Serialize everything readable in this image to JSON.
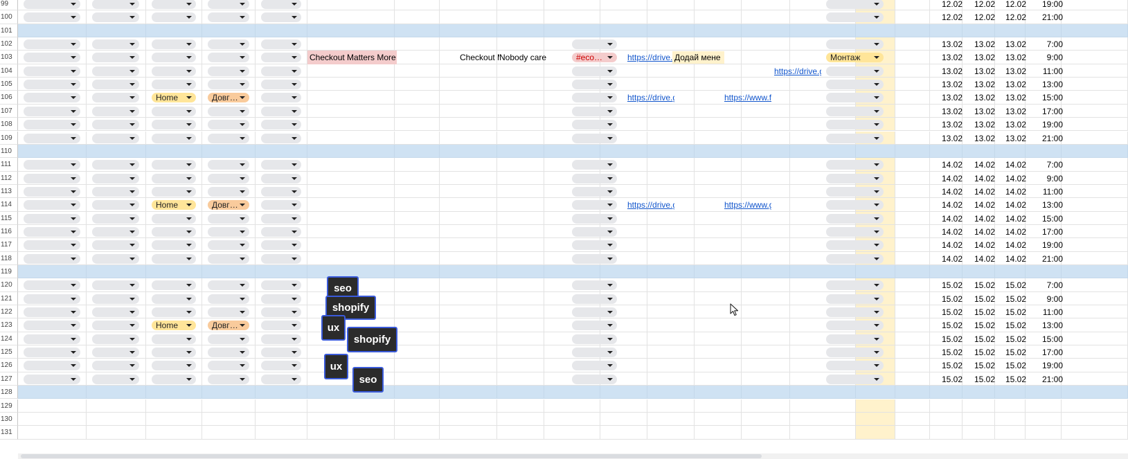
{
  "rows": [
    {
      "n": "99",
      "type": "data",
      "date": "12.02",
      "time": "19:00"
    },
    {
      "n": "100",
      "type": "data",
      "date": "12.02",
      "time": "21:00"
    },
    {
      "n": "101",
      "type": "sep"
    },
    {
      "n": "102",
      "type": "data",
      "date": "13.02",
      "time": "7:00",
      "c9": true
    },
    {
      "n": "103",
      "type": "data",
      "date": "13.02",
      "time": "9:00",
      "headline": "Checkout Matters More",
      "title": "Checkout Matte",
      "desc": "Nobody care",
      "c9": true,
      "hashtag": "#eco…",
      "link1": "https://drive.g",
      "note": "Додай мене",
      "stage": "Монтаж"
    },
    {
      "n": "104",
      "type": "data",
      "date": "13.02",
      "time": "11:00",
      "c9": true,
      "link3": "https://drive.g"
    },
    {
      "n": "105",
      "type": "data",
      "date": "13.02",
      "time": "13:00",
      "c9": true
    },
    {
      "n": "106",
      "type": "data",
      "date": "13.02",
      "time": "15:00",
      "c9": true,
      "cat": "Home",
      "dur": "Довг…",
      "link1": "https://drive.g",
      "link2": "https://www.f"
    },
    {
      "n": "107",
      "type": "data",
      "date": "13.02",
      "time": "17:00",
      "c9": true
    },
    {
      "n": "108",
      "type": "data",
      "date": "13.02",
      "time": "19:00",
      "c9": true
    },
    {
      "n": "109",
      "type": "data",
      "date": "13.02",
      "time": "21:00",
      "c9": true
    },
    {
      "n": "110",
      "type": "sep"
    },
    {
      "n": "111",
      "type": "data",
      "date": "14.02",
      "time": "7:00",
      "c9": true
    },
    {
      "n": "112",
      "type": "data",
      "date": "14.02",
      "time": "9:00",
      "c9": true
    },
    {
      "n": "113",
      "type": "data",
      "date": "14.02",
      "time": "11:00",
      "c9": true
    },
    {
      "n": "114",
      "type": "data",
      "date": "14.02",
      "time": "13:00",
      "c9": true,
      "cat": "Home",
      "dur": "Довг…",
      "link1": "https://drive.g",
      "link2": "https://www.g"
    },
    {
      "n": "115",
      "type": "data",
      "date": "14.02",
      "time": "15:00",
      "c9": true
    },
    {
      "n": "116",
      "type": "data",
      "date": "14.02",
      "time": "17:00",
      "c9": true
    },
    {
      "n": "117",
      "type": "data",
      "date": "14.02",
      "time": "19:00",
      "c9": true
    },
    {
      "n": "118",
      "type": "data",
      "date": "14.02",
      "time": "21:00",
      "c9": true
    },
    {
      "n": "119",
      "type": "sep"
    },
    {
      "n": "120",
      "type": "data",
      "date": "15.02",
      "time": "7:00",
      "c9": true
    },
    {
      "n": "121",
      "type": "data",
      "date": "15.02",
      "time": "9:00",
      "c9": true
    },
    {
      "n": "122",
      "type": "data",
      "date": "15.02",
      "time": "11:00",
      "c9": true
    },
    {
      "n": "123",
      "type": "data",
      "date": "15.02",
      "time": "13:00",
      "c9": true,
      "cat": "Home",
      "dur": "Довг…"
    },
    {
      "n": "124",
      "type": "data",
      "date": "15.02",
      "time": "15:00",
      "c9": true
    },
    {
      "n": "125",
      "type": "data",
      "date": "15.02",
      "time": "17:00",
      "c9": true
    },
    {
      "n": "126",
      "type": "data",
      "date": "15.02",
      "time": "19:00",
      "c9": true
    },
    {
      "n": "127",
      "type": "data",
      "date": "15.02",
      "time": "21:00",
      "c9": true
    },
    {
      "n": "128",
      "type": "sep"
    },
    {
      "n": "129",
      "type": "empty"
    },
    {
      "n": "130",
      "type": "empty"
    },
    {
      "n": "131",
      "type": "empty"
    }
  ],
  "floating_tags": [
    {
      "label": "seo"
    },
    {
      "label": "shopify"
    },
    {
      "label": "ux"
    },
    {
      "label": "shopify"
    },
    {
      "label": "ux"
    },
    {
      "label": "seo"
    }
  ],
  "colors": {
    "separator": "#cfe2f3",
    "yellow_column": "#fff2cc",
    "home_chip": "#ffe599",
    "duration_chip": "#f9cb9c",
    "hashtag_chip": "#f4cccc",
    "headline_bg": "#f4cccc",
    "link": "#1155cc",
    "tag_bg": "#2b2b2b",
    "tag_border": "#3b5bdb"
  },
  "icons": {
    "dropdown": "chevron-down-icon",
    "cursor": "mouse-pointer-icon"
  }
}
